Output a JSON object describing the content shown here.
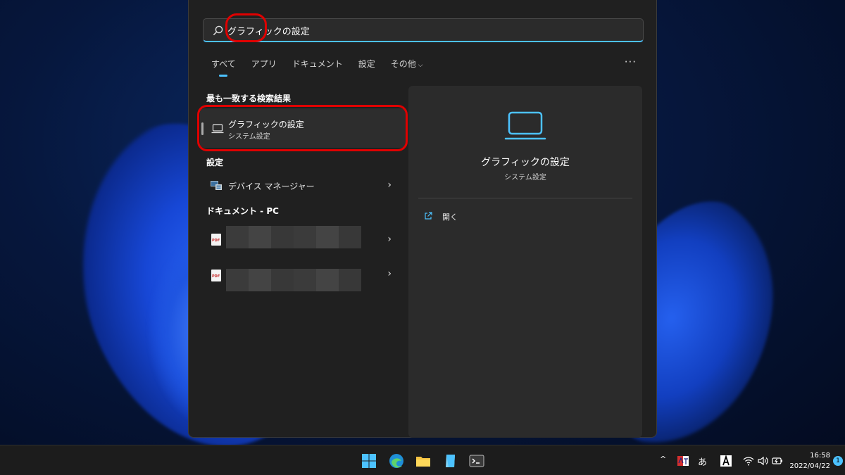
{
  "search": {
    "query": "グラフィックの設定"
  },
  "tabs": [
    {
      "label": "すべて"
    },
    {
      "label": "アプリ"
    },
    {
      "label": "ドキュメント"
    },
    {
      "label": "設定"
    },
    {
      "label": "その他"
    }
  ],
  "more_label": "···",
  "best_match": {
    "section_title": "最も一致する検索結果",
    "title": "グラフィックの設定",
    "subtitle": "システム設定"
  },
  "settings_section": {
    "title": "設定",
    "items": [
      {
        "label": "デバイス マネージャー"
      }
    ]
  },
  "documents_section": {
    "title": "ドキュメント - PC"
  },
  "preview": {
    "title": "グラフィックの設定",
    "subtitle": "システム設定",
    "open_label": "開く"
  },
  "taskbar": {
    "tray_ime_label": "あ",
    "time": "16:58",
    "date": "2022/04/22",
    "notification_count": "1"
  },
  "colors": {
    "accent": "#4cc2ff",
    "highlight_ring": "#e00000",
    "panel_bg": "#202020",
    "preview_bg": "#2b2b2b"
  }
}
